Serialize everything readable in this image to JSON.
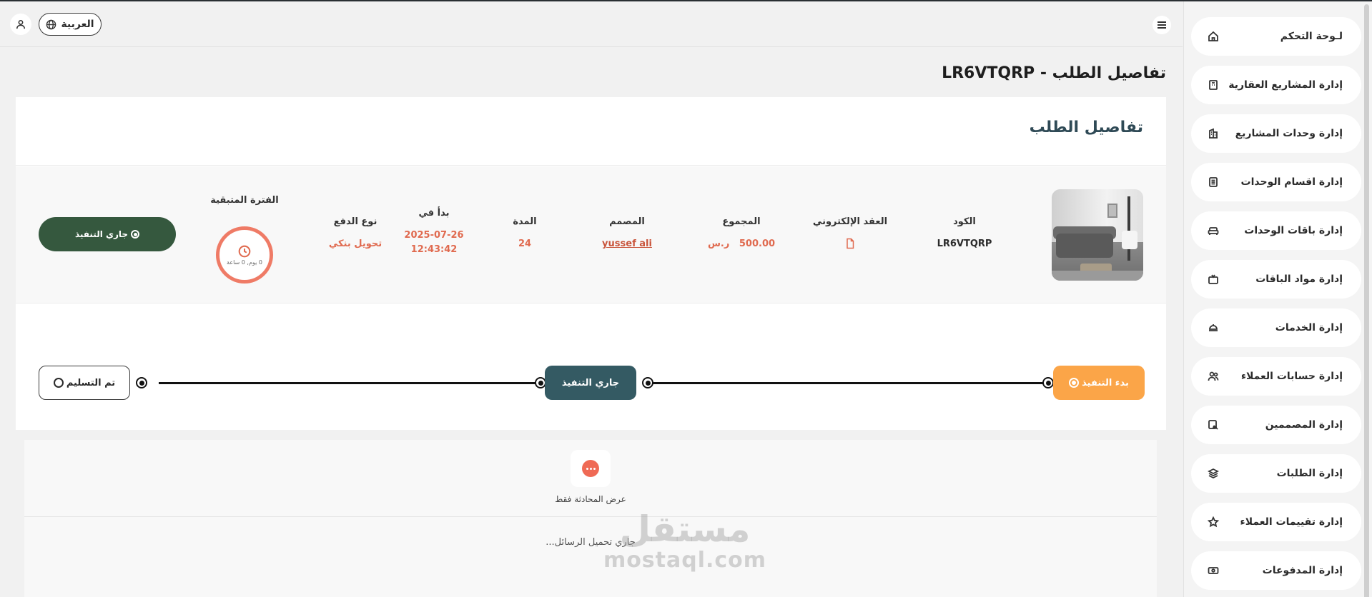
{
  "topbar": {
    "language_label": "العربية"
  },
  "sidebar": {
    "items": [
      {
        "label": "لـوحة التحكم",
        "icon": "home-icon"
      },
      {
        "label": "إدارة المشاريع العقارية",
        "icon": "building-plan-icon"
      },
      {
        "label": "إدارة وحدات المشاريع",
        "icon": "apartment-icon"
      },
      {
        "label": "إدارة اقسام الوحدات",
        "icon": "list-icon"
      },
      {
        "label": "إدارة باقات الوحدات",
        "icon": "sofa-icon"
      },
      {
        "label": "إدارة مواد الباقات",
        "icon": "tv-icon"
      },
      {
        "label": "إدارة الخدمات",
        "icon": "service-icon"
      },
      {
        "label": "إدارة حسابات العملاء",
        "icon": "users-icon"
      },
      {
        "label": "إدارة المصممين",
        "icon": "designer-icon"
      },
      {
        "label": "إدارة الطلبات",
        "icon": "layers-icon"
      },
      {
        "label": "إدارة تقييمات العملاء",
        "icon": "star-icon"
      },
      {
        "label": "إدارة المدفوعات",
        "icon": "cash-icon"
      }
    ]
  },
  "page": {
    "title": "تفاصيل الطلب - LR6VTQRP"
  },
  "card": {
    "title": "تفاصيل الطلب",
    "fields": {
      "code": {
        "label": "الكود",
        "value": "LR6VTQRP"
      },
      "contract": {
        "label": "العقد الإلكتروني",
        "icon": "file-icon"
      },
      "total": {
        "label": "المجموع",
        "value": "500.00",
        "currency": "ر.س"
      },
      "designer": {
        "label": "المصمم",
        "value": "yussef ali"
      },
      "duration": {
        "label": "المدة",
        "value": "24"
      },
      "started": {
        "label": "بدأ في",
        "date": "2025-07-26",
        "time": "12:43:42"
      },
      "payment": {
        "label": "نوع الدفع",
        "value": "تحويل بنكي"
      },
      "remaining": {
        "label": "الفترة المتبقية",
        "value": "0 يوم, 0 ساعة"
      }
    },
    "status_button": "جاري التنفيذ"
  },
  "progress": {
    "steps": [
      {
        "label": "بدء التنفيذ",
        "state": "done"
      },
      {
        "label": "جاري التنفيذ",
        "state": "current"
      },
      {
        "label": "تم التسليم",
        "state": "pending"
      }
    ]
  },
  "chat": {
    "caption": "عرض المحادثة فقط",
    "loading": "جاري تحميل الرسائل..."
  },
  "watermark": {
    "arabic": "مستقل",
    "latin": "mostaql.com"
  },
  "colors": {
    "accent_orange": "#fba548",
    "status_green": "#35583e",
    "step_teal": "#345a63",
    "value_red": "#e06a4f"
  }
}
